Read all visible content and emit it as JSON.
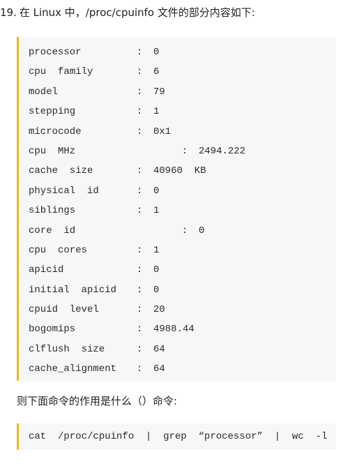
{
  "question": {
    "number": "19.",
    "text": "在 Linux 中，/proc/cpuinfo 文件的部分内容如下:"
  },
  "cpuinfo_lines": [
    {
      "key": "processor",
      "value": "0"
    },
    {
      "key": "cpu  family",
      "value": "6"
    },
    {
      "key": "model",
      "value": "79"
    },
    {
      "key": "stepping",
      "value": "1"
    },
    {
      "key": "microcode",
      "value": "0x1"
    },
    {
      "key": "cpu  MHz",
      "value": "2494.222"
    },
    {
      "key": "cache  size",
      "value": "40960  KB"
    },
    {
      "key": "physical  id",
      "value": "0"
    },
    {
      "key": "siblings",
      "value": "1"
    },
    {
      "key": "core  id",
      "value": "0"
    },
    {
      "key": "cpu  cores",
      "value": "1"
    },
    {
      "key": "apicid",
      "value": "0"
    },
    {
      "key": "initial  apicid",
      "value": "0"
    },
    {
      "key": "cpuid  level",
      "value": "20"
    },
    {
      "key": "bogomips",
      "value": "4988.44"
    },
    {
      "key": "clflush  size",
      "value": "64"
    },
    {
      "key": "cache_alignment",
      "value": "64"
    }
  ],
  "colon": ":",
  "follow_question": "则下面命令的作用是什么（）命令:",
  "command": "cat  /proc/cpuinfo  |  grep  “processor”  |  wc  -l",
  "colors": {
    "code_background": "#f6f7f8",
    "accent_border": "#f3b81d"
  }
}
